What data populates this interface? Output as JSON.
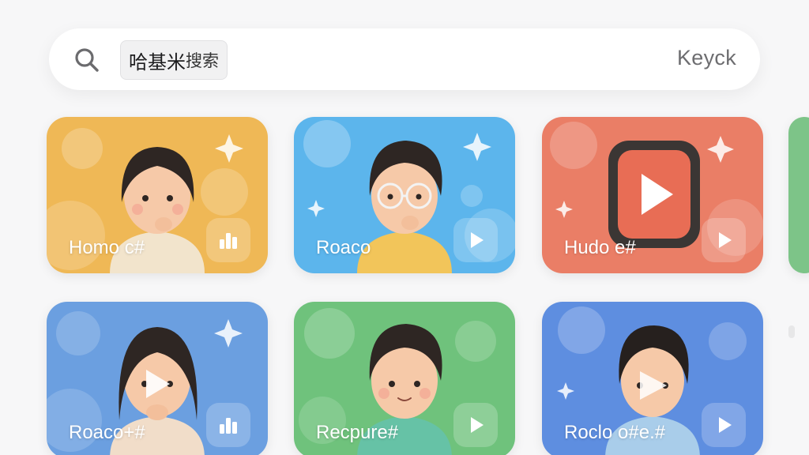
{
  "search": {
    "query_primary": "哈基米",
    "query_secondary": "搜索",
    "hint": "Keyck"
  },
  "cards": [
    {
      "title": "Homo c#",
      "action_icon": "bar-chart-icon",
      "color": "#efb856"
    },
    {
      "title": "Roaco",
      "action_icon": "play-icon",
      "color": "#5cb5ec"
    },
    {
      "title": "Hudo e#",
      "action_icon": "play-icon",
      "color": "#ea7e66"
    },
    {
      "title": "Roaco+#",
      "action_icon": "bar-chart-icon",
      "color": "#6b9fe0"
    },
    {
      "title": "Recpure#",
      "action_icon": "play-icon",
      "color": "#6fc27c"
    },
    {
      "title": "Roclo o#e.#",
      "action_icon": "play-icon",
      "color": "#5e8ee0"
    }
  ]
}
